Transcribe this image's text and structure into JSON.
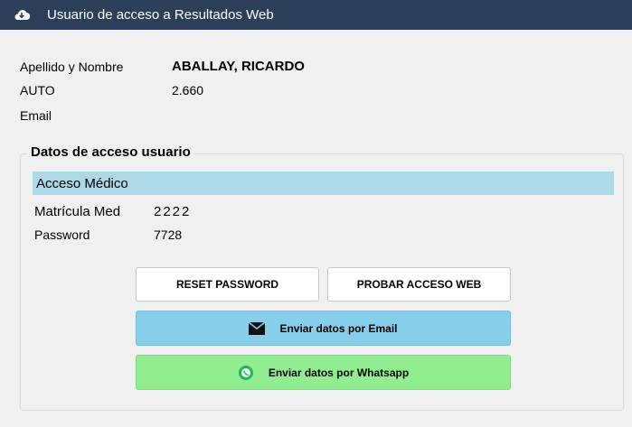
{
  "window": {
    "title": "Usuario de acceso a Resultados Web",
    "icon": "cloud-icon"
  },
  "info": {
    "name_label": "Apellido y Nombre",
    "name_value": "ABALLAY, RICARDO",
    "auto_label": "AUTO",
    "auto_value": "2.660",
    "email_label": "Email",
    "email_value": ""
  },
  "access": {
    "group_title": "Datos de acceso usuario",
    "section_title": "Acceso Médico",
    "matricula_label": "Matrícula Med",
    "matricula_value": "2222",
    "password_label": "Password",
    "password_value": "7728"
  },
  "buttons": {
    "reset": "RESET PASSWORD",
    "test": "PROBAR ACCESO WEB",
    "email": "Enviar datos por Email",
    "whatsapp": "Enviar datos por Whatsapp"
  },
  "colors": {
    "titlebar": "#2c3e58",
    "section": "#add8e6",
    "email_button": "#87ceeb",
    "whatsapp_button": "#90ee90"
  }
}
